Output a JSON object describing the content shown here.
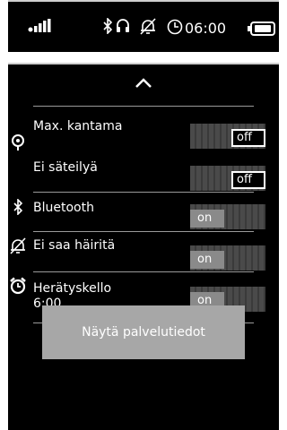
{
  "statusbar": {
    "time": "06:00",
    "icons": [
      "signal-icon",
      "bluetooth-icon",
      "headset-icon",
      "do-not-disturb-icon",
      "alarm-icon",
      "battery-icon"
    ]
  },
  "panel": {
    "collapse_icon": "chevron-up-icon",
    "rows": [
      {
        "label": "Max. kantama",
        "state": "off",
        "icon": "range-icon"
      },
      {
        "label": "Ei säteilyä",
        "state": "off",
        "icon": ""
      },
      {
        "label": "Bluetooth",
        "state": "on",
        "icon": "bluetooth-icon"
      },
      {
        "label": "Ei saa häiritä",
        "state": "on",
        "icon": "do-not-disturb-icon"
      },
      {
        "label": "Herätyskello",
        "sublabel": "6:00",
        "state": "on",
        "icon": "alarm-icon"
      }
    ],
    "service_button": "Näytä palvelutiedot"
  },
  "colors": {
    "background": "#000000",
    "switch_on_knob": "#8a8a8a",
    "button": "#a7a7a7"
  }
}
